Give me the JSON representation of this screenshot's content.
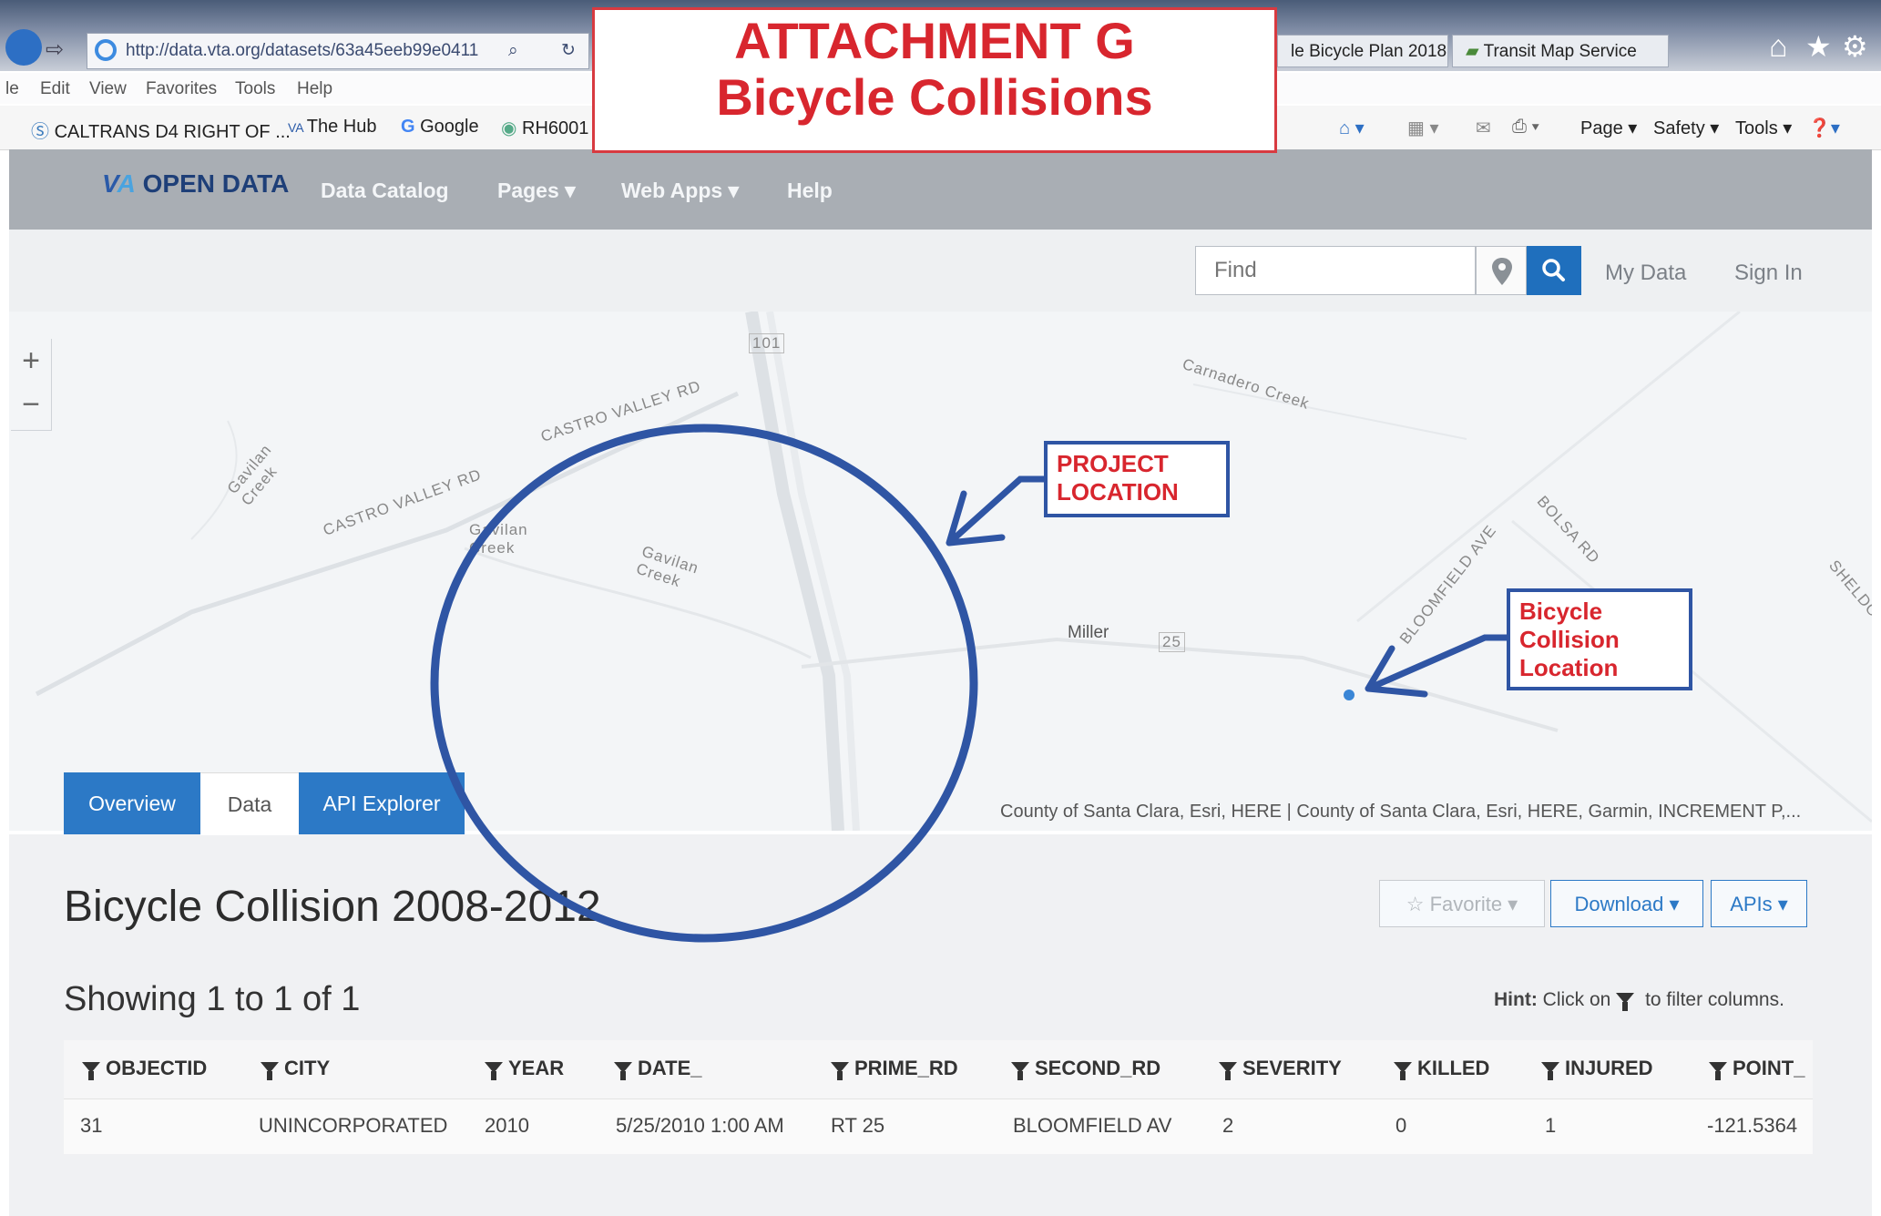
{
  "browser": {
    "url": "http://data.vta.org/datasets/63a45eeb99e0411",
    "tabs": [
      "le Bicycle Plan 2018",
      "Transit Map Service"
    ],
    "menu": [
      "le",
      "Edit",
      "View",
      "Favorites",
      "Tools",
      "Help"
    ],
    "favorites": [
      "CALTRANS D4 RIGHT OF ...",
      "The Hub",
      "Google",
      "RH6001"
    ],
    "commands": [
      "Page ▾",
      "Safety ▾",
      "Tools ▾"
    ]
  },
  "attachment": {
    "line1": "ATTACHMENT G",
    "line2": "Bicycle Collisions"
  },
  "site": {
    "logo_text": "OPEN DATA",
    "nav": [
      "Data Catalog",
      "Pages ▾",
      "Web Apps ▾",
      "Help"
    ],
    "search_placeholder": "Find",
    "my_data": "My Data",
    "sign_in": "Sign In"
  },
  "map": {
    "zoom_in": "+",
    "zoom_out": "−",
    "labels": {
      "highway": "101",
      "castro_valley_rd_1": "CASTRO VALLEY RD",
      "castro_valley_rd_2": "CASTRO VALLEY RD",
      "gavilan_1": "Gavilan Creek",
      "gavilan_2": "Gavilan Creek",
      "gavilan_3": "Gavilan Creek",
      "carnadero": "Carnadero Creek",
      "bloomfield": "BLOOMFIELD AVE",
      "bolsa": "BOLSA RD",
      "sheldon": "SHELDON",
      "miller": "Miller",
      "route25": "25"
    },
    "attribution": "County of Santa Clara, Esri, HERE | County of Santa Clara, Esri, HERE, Garmin, INCREMENT P,...",
    "callout_project": "PROJECT LOCATION",
    "callout_collision": "Bicycle Collision Location"
  },
  "tabs": {
    "overview": "Overview",
    "data": "Data",
    "api": "API Explorer"
  },
  "page": {
    "title": "Bicycle Collision 2008-2012",
    "showing": "Showing 1 to 1 of 1",
    "hint_bold": "Hint:",
    "hint_text1": "Click on",
    "hint_text2": "to filter columns.",
    "favorite": "☆ Favorite ▾",
    "download": "Download ▾",
    "apis": "APIs ▾"
  },
  "table": {
    "columns": [
      "OBJECTID",
      "CITY",
      "YEAR",
      "DATE_",
      "PRIME_RD",
      "SECOND_RD",
      "SEVERITY",
      "KILLED",
      "INJURED",
      "POINT_"
    ],
    "rows": [
      [
        "31",
        "UNINCORPORATED",
        "2010",
        "5/25/2010 1:00 AM",
        "RT 25",
        "BLOOMFIELD AV",
        "2",
        "0",
        "1",
        "-121.5364"
      ]
    ]
  },
  "colors": {
    "accent_blue": "#2c79c6",
    "callout_red": "#d8262e",
    "circle_blue": "#2f55a4"
  }
}
